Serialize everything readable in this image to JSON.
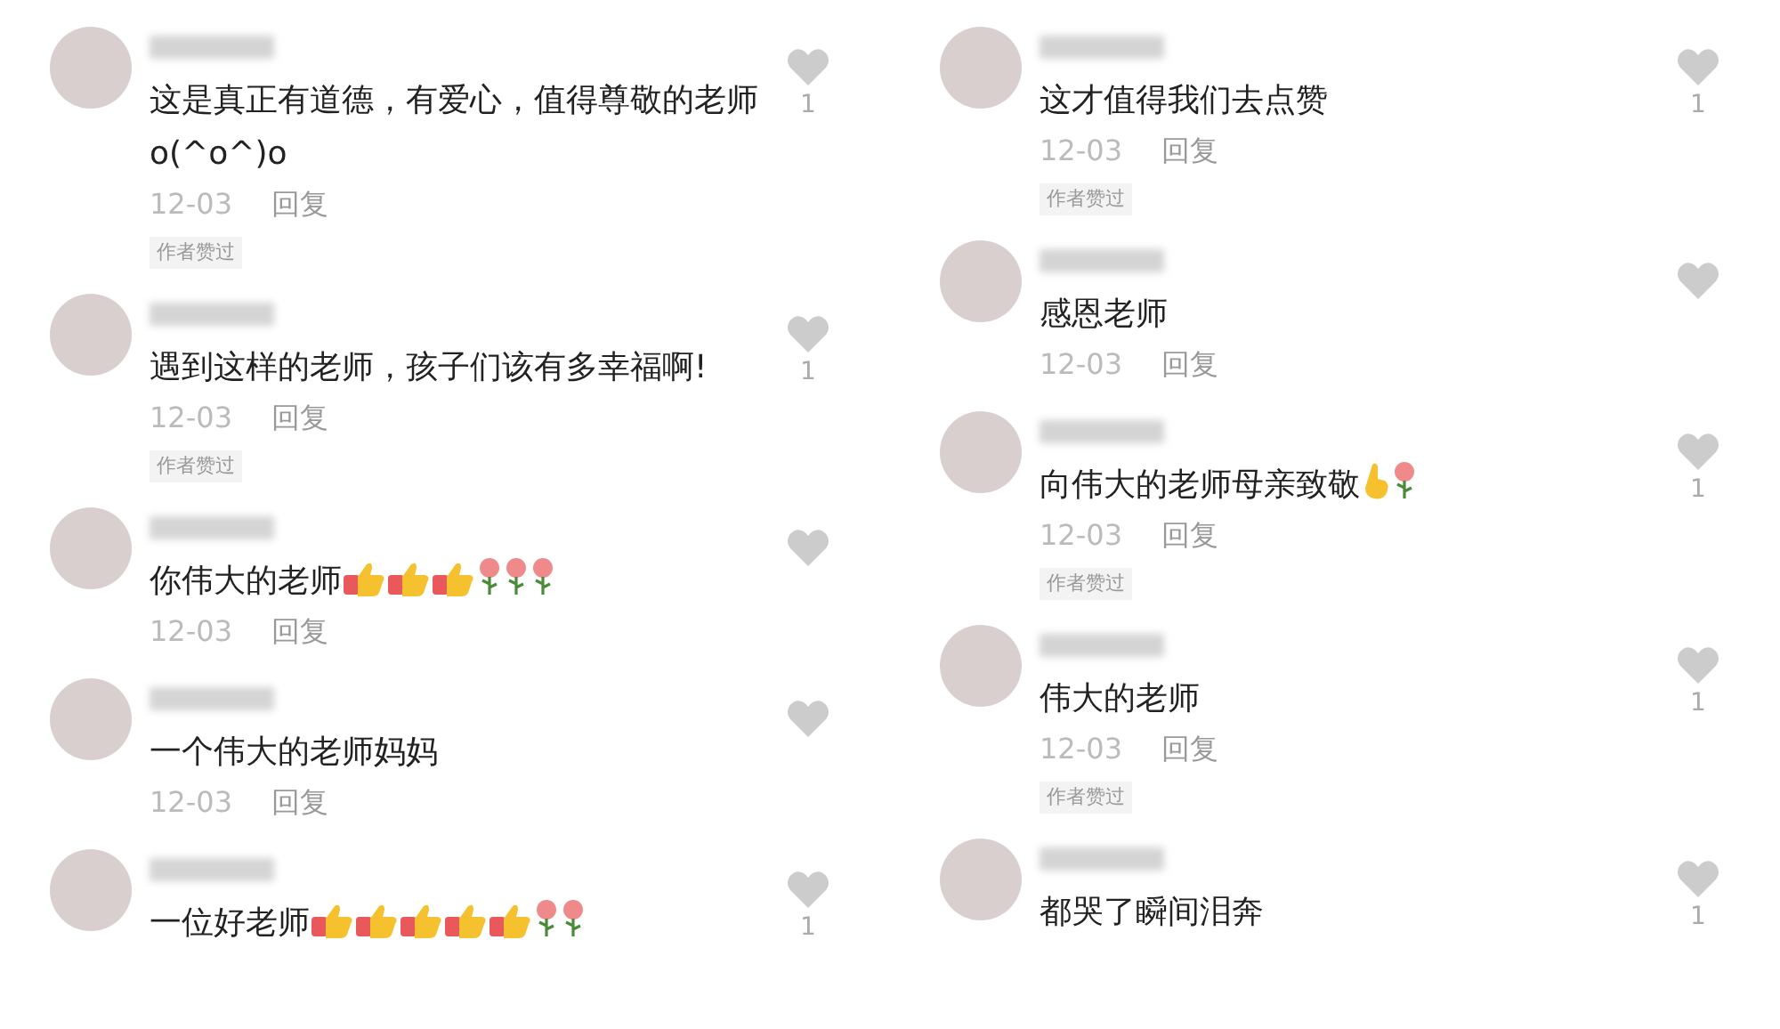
{
  "columns": [
    {
      "comments": [
        {
          "text": "这是真正有道德，有爱心，值得尊敬的老师o(^o^)o",
          "date": "12-03",
          "reply": "回复",
          "author_liked": "作者赞过",
          "liked": false,
          "likes": "1"
        },
        {
          "text": "遇到这样的老师，孩子们该有多幸福啊!",
          "date": "12-03",
          "reply": "回复",
          "author_liked": "作者赞过",
          "liked": false,
          "likes": "1"
        },
        {
          "text": "你伟大的老师",
          "emojis": [
            {
              "kind": "thumbs"
            },
            {
              "kind": "thumbs"
            },
            {
              "kind": "thumbs"
            },
            {
              "kind": "rose"
            },
            {
              "kind": "rose"
            },
            {
              "kind": "rose"
            }
          ],
          "date": "12-03",
          "reply": "回复",
          "liked": false
        },
        {
          "text": "一个伟大的老师妈妈",
          "date": "12-03",
          "reply": "回复",
          "liked": false
        },
        {
          "text": "一位好老师",
          "emojis": [
            {
              "kind": "thumbs"
            },
            {
              "kind": "thumbs"
            },
            {
              "kind": "thumbs"
            },
            {
              "kind": "thumbs"
            },
            {
              "kind": "thumbs"
            },
            {
              "kind": "rose"
            },
            {
              "kind": "rose"
            }
          ],
          "liked": false,
          "likes": "1"
        }
      ]
    },
    {
      "comments": [
        {
          "text": "这才值得我们去点赞",
          "date": "12-03",
          "reply": "回复",
          "author_liked": "作者赞过",
          "liked": false,
          "likes": "1"
        },
        {
          "text": "感恩老师",
          "date": "12-03",
          "reply": "回复",
          "liked": false
        },
        {
          "text": "向伟大的老师母亲致敬",
          "emojis": [
            {
              "kind": "hand"
            },
            {
              "kind": "rose"
            }
          ],
          "date": "12-03",
          "reply": "回复",
          "author_liked": "作者赞过",
          "liked": false,
          "likes": "1"
        },
        {
          "text": "伟大的老师",
          "date": "12-03",
          "reply": "回复",
          "author_liked": "作者赞过",
          "liked": false,
          "likes": "1"
        },
        {
          "text": "都哭了瞬间泪奔",
          "liked": false,
          "likes": "1"
        }
      ]
    }
  ]
}
